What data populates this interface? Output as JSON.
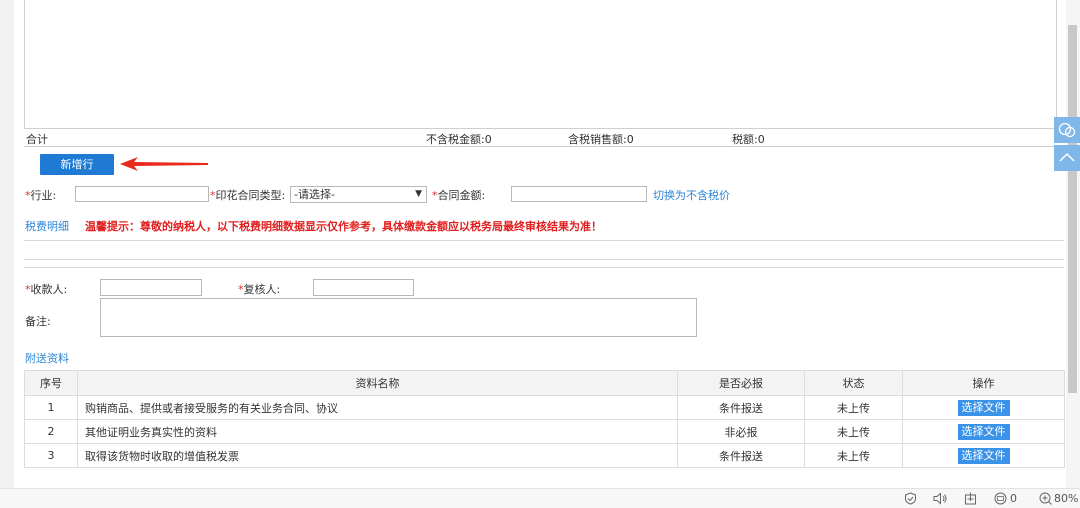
{
  "totals": {
    "label": "合计",
    "ex_tax_amount": "不含税金额:0",
    "incl_tax_sales": "含税销售额:0",
    "tax_amount": "税额:0"
  },
  "add_row_button": "新增行",
  "form": {
    "required_mark": "*",
    "industry_label": "行业:",
    "contract_type_label": "印花合同类型:",
    "contract_type_selected": "-请选择-",
    "contract_amount_label": "合同金额:",
    "switch_tax_link": "切换为不含税价",
    "tax_detail_link": "税费明细",
    "warning": "温馨提示：尊敬的纳税人，以下税费明细数据显示仅作参考，具体缴款金额应以税务局最终审核结果为准！",
    "payee_label": "收款人:",
    "reviewer_label": "复核人:",
    "remark_label": "备注:"
  },
  "attachments": {
    "title": "附送资料",
    "headers": [
      "序号",
      "资料名称",
      "是否必报",
      "状态",
      "操作"
    ],
    "rows": [
      {
        "no": "1",
        "name": "购销商品、提供或者接受服务的有关业务合同、协议",
        "required": "条件报送",
        "status": "未上传",
        "action": "选择文件"
      },
      {
        "no": "2",
        "name": "其他证明业务真实性的资料",
        "required": "非必报",
        "status": "未上传",
        "action": "选择文件"
      },
      {
        "no": "3",
        "name": "取得该货物时收取的增值税发票",
        "required": "条件报送",
        "status": "未上传",
        "action": "选择文件"
      }
    ]
  },
  "statusbar": {
    "icons": [
      "shield-icon",
      "speaker-icon",
      "download-box-icon",
      "ad-block-icon",
      "zoom-icon"
    ],
    "ad_count": "0",
    "zoom": "80%"
  },
  "colors": {
    "primary": "#1e7ad2",
    "link": "#2c85d6",
    "warning": "#e02020",
    "required": "#d9302c",
    "arrow": "#e8291c"
  }
}
